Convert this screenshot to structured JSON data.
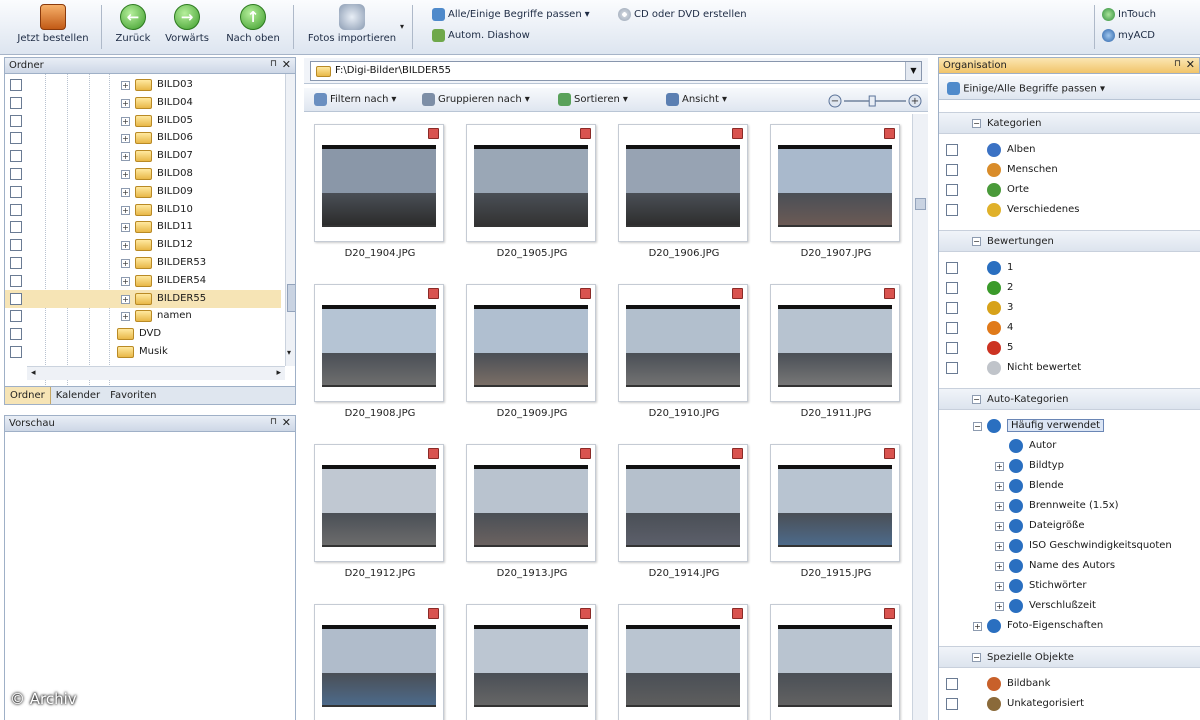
{
  "toolbar": {
    "order": "Jetzt bestellen",
    "back": "Zurück",
    "forward": "Vorwärts",
    "up": "Nach oben",
    "import": "Fotos importieren",
    "match": "Alle/Einige Begriffe passen",
    "cd": "CD oder DVD erstellen",
    "slideshow": "Autom. Diashow",
    "intouch": "InTouch",
    "myacd": "myACD"
  },
  "folder_panel": {
    "title": "Ordner",
    "items": [
      {
        "label": "BILD03"
      },
      {
        "label": "BILD04"
      },
      {
        "label": "BILD05"
      },
      {
        "label": "BILD06"
      },
      {
        "label": "BILD07"
      },
      {
        "label": "BILD08"
      },
      {
        "label": "BILD09"
      },
      {
        "label": "BILD10"
      },
      {
        "label": "BILD11"
      },
      {
        "label": "BILD12"
      },
      {
        "label": "BILDER53"
      },
      {
        "label": "BILDER54"
      },
      {
        "label": "BILDER55"
      },
      {
        "label": "namen"
      },
      {
        "label": "DVD"
      },
      {
        "label": "Musik"
      }
    ],
    "selected": "BILDER55"
  },
  "left_tabs": {
    "folders": "Ordner",
    "calendar": "Kalender",
    "favorites": "Favoriten"
  },
  "preview_panel": {
    "title": "Vorschau"
  },
  "center": {
    "path": "F:\\Digi-Bilder\\BILDER55",
    "filter": "Filtern nach",
    "group": "Gruppieren nach",
    "sort": "Sortieren",
    "view": "Ansicht",
    "zoom_level": 0.45
  },
  "thumbnails": [
    {
      "name": "D20_1904.JPG",
      "sky": "#8a97a8",
      "ground": "#2c2c2c"
    },
    {
      "name": "D20_1905.JPG",
      "sky": "#9aa7b6",
      "ground": "#333"
    },
    {
      "name": "D20_1906.JPG",
      "sky": "#97a3b3",
      "ground": "#2e2e2e"
    },
    {
      "name": "D20_1907.JPG",
      "sky": "#a9b9cc",
      "ground": "#6b5a55"
    },
    {
      "name": "D20_1908.JPG",
      "sky": "#b5c4d4",
      "ground": "#6e6e6e"
    },
    {
      "name": "D20_1909.JPG",
      "sky": "#b0bfd0",
      "ground": "#7a6e66"
    },
    {
      "name": "D20_1910.JPG",
      "sky": "#b2bfcd",
      "ground": "#727272"
    },
    {
      "name": "D20_1911.JPG",
      "sky": "#b7c3d0",
      "ground": "#777"
    },
    {
      "name": "D20_1912.JPG",
      "sky": "#c0c8d2",
      "ground": "#6c6c6c"
    },
    {
      "name": "D20_1913.JPG",
      "sky": "#b9c3cf",
      "ground": "#6a6260"
    },
    {
      "name": "D20_1914.JPG",
      "sky": "#b5c0cc",
      "ground": "#5c5f6a"
    },
    {
      "name": "D20_1915.JPG",
      "sky": "#b8c4d1",
      "ground": "#4d6a8a"
    },
    {
      "name": "",
      "sky": "#b0bccb",
      "ground": "#4d6a8a"
    },
    {
      "name": "",
      "sky": "#bcc6d2",
      "ground": "#666"
    },
    {
      "name": "",
      "sky": "#bac5d1",
      "ground": "#5e5e5e"
    },
    {
      "name": "",
      "sky": "#b9c4d0",
      "ground": "#626262"
    }
  ],
  "organize": {
    "title": "Organisation",
    "match": "Einige/Alle Begriffe passen",
    "categories": {
      "title": "Kategorien",
      "items": [
        "Alben",
        "Menschen",
        "Orte",
        "Verschiedenes"
      ]
    },
    "ratings": {
      "title": "Bewertungen",
      "items": [
        "1",
        "2",
        "3",
        "4",
        "5"
      ],
      "unrated": "Nicht bewertet"
    },
    "auto": {
      "title": "Auto-Kategorien",
      "frequent": "Häufig verwendet",
      "items": [
        "Autor",
        "Bildtyp",
        "Blende",
        "Brennweite (1.5x)",
        "Dateigröße",
        "ISO Geschwindigkeitsquoten",
        "Name des Autors",
        "Stichwörter",
        "Verschlußzeit"
      ],
      "photo_props": "Foto-Eigenschaften"
    },
    "special": {
      "title": "Spezielle Objekte",
      "items": [
        "Bildbank",
        "Unkategorisiert"
      ]
    }
  },
  "watermark": "© Archiv",
  "colors": {
    "accent": "#f6e4b5",
    "header": "#dde5f0",
    "rating": [
      "#2a6fc0",
      "#3a9a2a",
      "#d7a21a",
      "#e07a1a",
      "#cc3322"
    ]
  }
}
